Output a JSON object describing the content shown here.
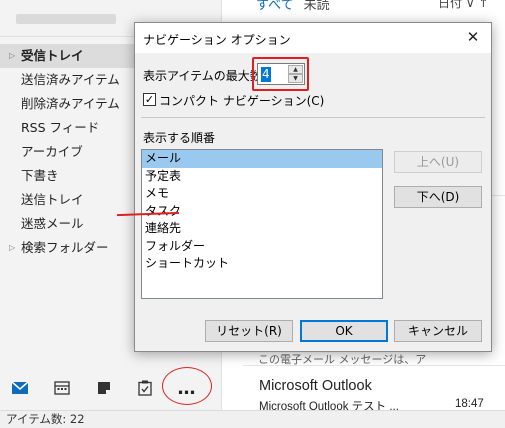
{
  "folder_pane": {
    "folders": [
      {
        "label": "受信トレイ",
        "chevron": "▷",
        "selected": true
      },
      {
        "label": "送信済みアイテム"
      },
      {
        "label": "削除済みアイテム"
      },
      {
        "label": "RSS フィード"
      },
      {
        "label": "アーカイブ"
      },
      {
        "label": "下書き"
      },
      {
        "label": "送信トレイ"
      },
      {
        "label": "迷惑メール"
      },
      {
        "label": "検索フォルダー",
        "chevron": "▷"
      }
    ],
    "nav_more_label": "…"
  },
  "status_bar": {
    "item_count": "アイテム数: 22"
  },
  "message_list": {
    "tab_all": "すべて",
    "tab_unread": "未読",
    "sort_label": "日付 ∨   ↑",
    "preview_line": "この電子メール メッセージは、ア",
    "sender": "Microsoft Outlook",
    "subject": "Microsoft Outlook テスト ...",
    "time": "18:47"
  },
  "dialog": {
    "title": "ナビゲーション オプション",
    "max_items_label": "表示アイテムの最大数",
    "max_items_value": "4",
    "compact_nav_label": "コンパクト ナビゲーション(C)",
    "compact_nav_checked": "✓",
    "order_label": "表示する順番",
    "order_items": [
      "メール",
      "予定表",
      "メモ",
      "タスク",
      "連絡先",
      "フォルダー",
      "ショートカット"
    ],
    "up_button": "上へ(U)",
    "down_button": "下へ(D)",
    "reset_button": "リセット(R)",
    "ok_button": "OK",
    "cancel_button": "キャンセル",
    "close_glyph": "✕"
  },
  "colors": {
    "accent": "#0078d7",
    "annotation": "#e02020",
    "selection": "#99c9ef"
  }
}
